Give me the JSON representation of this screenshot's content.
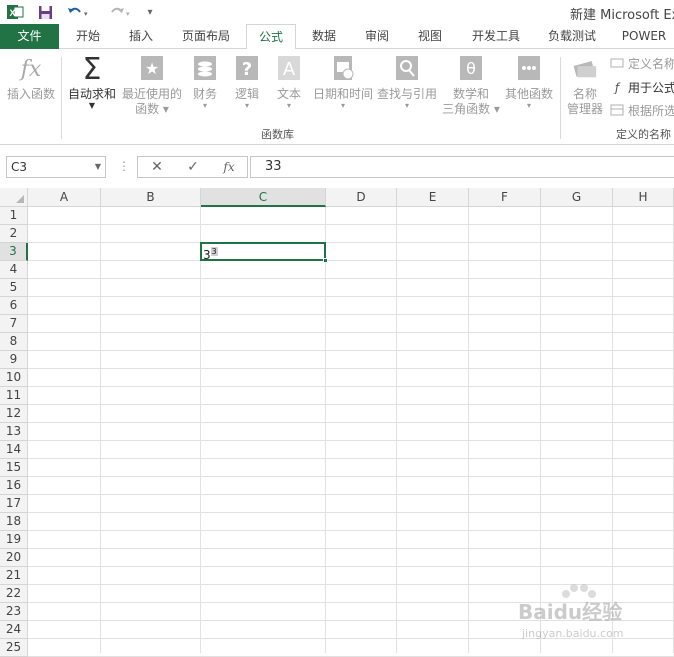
{
  "window": {
    "title": "新建 Microsoft Excel"
  },
  "tabs": [
    {
      "label": "文件"
    },
    {
      "label": "开始"
    },
    {
      "label": "插入"
    },
    {
      "label": "页面布局"
    },
    {
      "label": "公式"
    },
    {
      "label": "数据"
    },
    {
      "label": "审阅"
    },
    {
      "label": "视图"
    },
    {
      "label": "开发工具"
    },
    {
      "label": "负载测试"
    },
    {
      "label": "POWER"
    }
  ],
  "ribbon": {
    "insert_function": "插入函数",
    "autosum": "自动求和",
    "recent_l1": "最近使用的",
    "recent_l2": "函数",
    "financial": "财务",
    "logical": "逻辑",
    "text": "文本",
    "datetime": "日期和时间",
    "lookup": "查找与引用",
    "math_l1": "数学和",
    "math_l2": "三角函数",
    "other": "其他函数",
    "group_library": "函数库",
    "name_mgr_l1": "名称",
    "name_mgr_l2": "管理器",
    "define_name": "定义名称",
    "use_in_formula": "用于公式",
    "create_from_sel": "根据所选",
    "group_names": "定义的名称"
  },
  "formula_bar": {
    "name_box": "C3",
    "value": "33",
    "fx_label": "fx"
  },
  "grid": {
    "columns": [
      "A",
      "B",
      "C",
      "D",
      "E",
      "F",
      "G",
      "H"
    ],
    "rows": [
      "1",
      "2",
      "3",
      "4",
      "5",
      "6",
      "7",
      "8",
      "9",
      "10",
      "11",
      "12",
      "13",
      "14",
      "15",
      "16",
      "17",
      "18",
      "19",
      "20",
      "21",
      "22",
      "23",
      "24",
      "25"
    ],
    "active_cell": "C3",
    "cells": {
      "C3_base": "3",
      "C3_sup": "3"
    }
  },
  "watermark": {
    "text": "Baidu经验",
    "sub": "jingyan.baidu.com"
  },
  "colors": {
    "accent": "#217346",
    "header_bg": "#f3f3f3",
    "grid_line": "#e1e1e1"
  }
}
